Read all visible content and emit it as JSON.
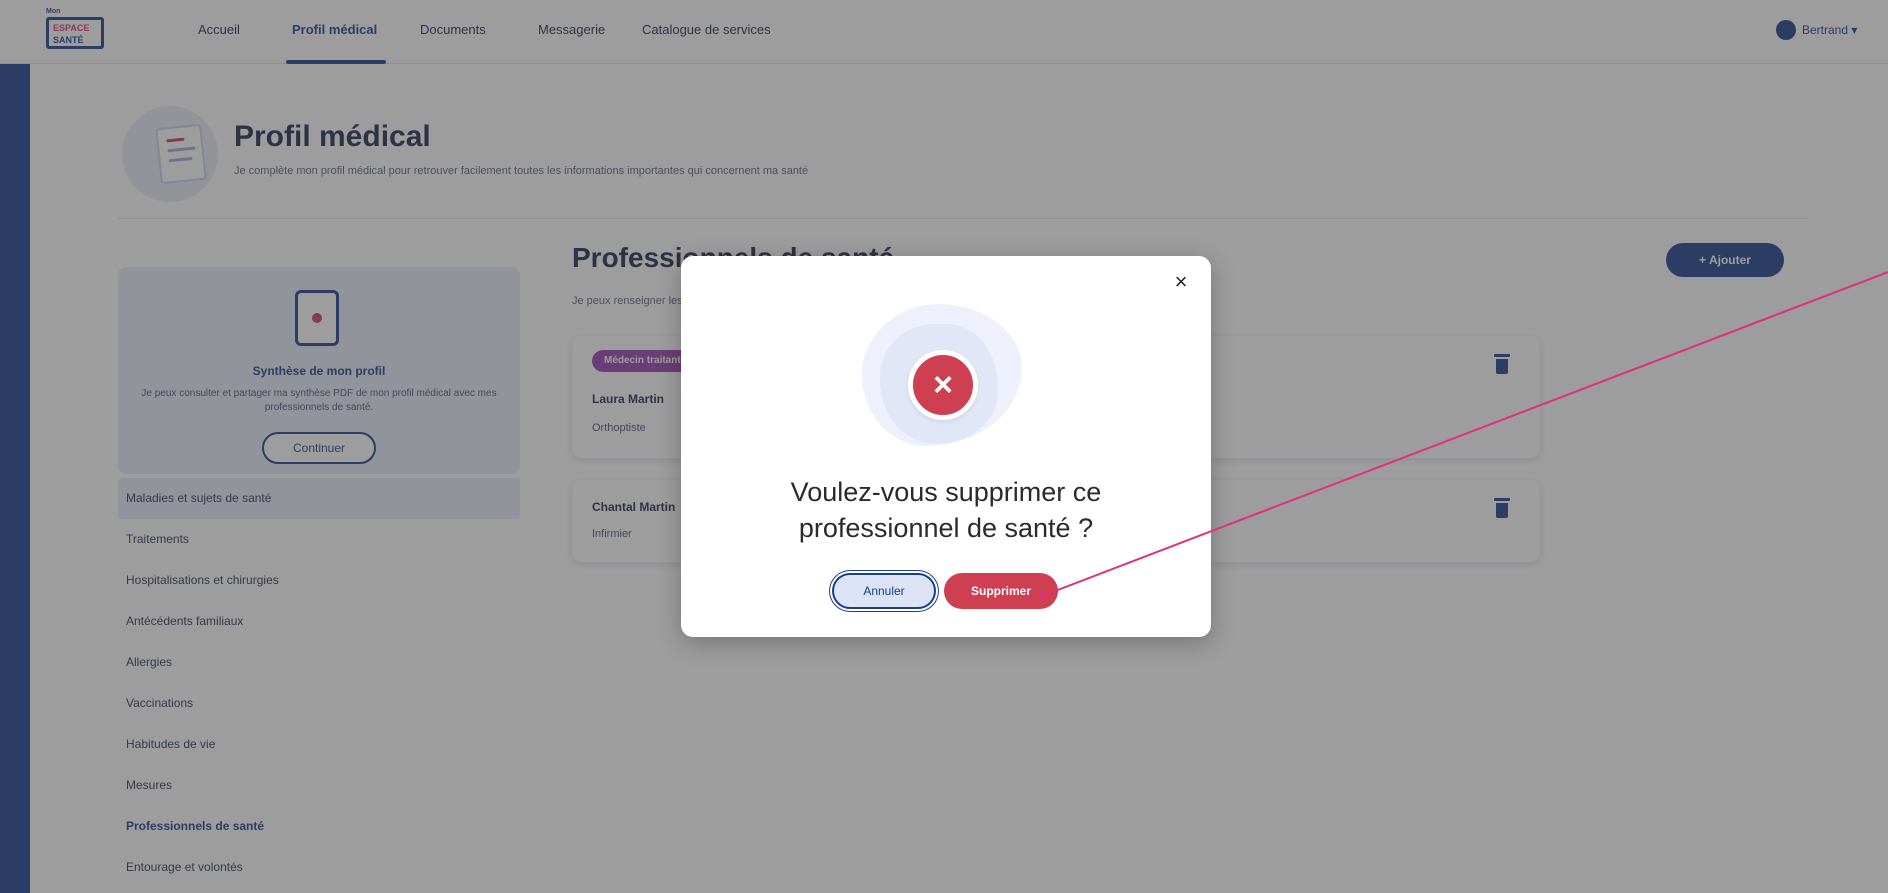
{
  "nav": {
    "logo_lines": [
      "Mon",
      "ESPACE",
      "SANTÉ"
    ],
    "items": [
      "Accueil",
      "Profil médical",
      "Documents",
      "Messagerie",
      "Catalogue de services"
    ],
    "user_label": "Bertrand ▾"
  },
  "page": {
    "title": "Profil médical",
    "subtitle": "Je complète mon profil médical pour retrouver facilement toutes les informations importantes qui concernent ma santé"
  },
  "sidebar": {
    "synthesis_title": "Synthèse de mon profil",
    "synthesis_desc": "Je peux consulter et partager ma synthèse PDF de mon profil médical avec mes professionnels de santé.",
    "synthesis_button": "Continuer",
    "items": [
      "Maladies et sujets de santé",
      "Traitements",
      "Hospitalisations et chirurgies",
      "Antécédents familiaux",
      "Allergies",
      "Vaccinations",
      "Habitudes de vie",
      "Mesures",
      "Professionnels de santé",
      "Entourage et volontés"
    ]
  },
  "main": {
    "title": "Professionnels de santé",
    "subtitle": "Je peux renseigner les professionnels de santé qui me suivent",
    "add_button": "+ Ajouter",
    "cards": [
      {
        "tag": "Médecin traitant",
        "name": "Laura Martin",
        "role": "Orthoptiste"
      },
      {
        "name": "Chantal Martin",
        "role": "Infirmier"
      }
    ]
  },
  "modal": {
    "question": "Voulez-vous supprimer ce professionnel de santé ?",
    "cancel_label": "Annuler",
    "delete_label": "Supprimer",
    "close_icon": "×",
    "status_icon": "×"
  },
  "colors": {
    "brand": "#1a3e8c",
    "danger": "#cf3f52",
    "tag": "#9b3fb5",
    "annotation": "#e0307a"
  }
}
